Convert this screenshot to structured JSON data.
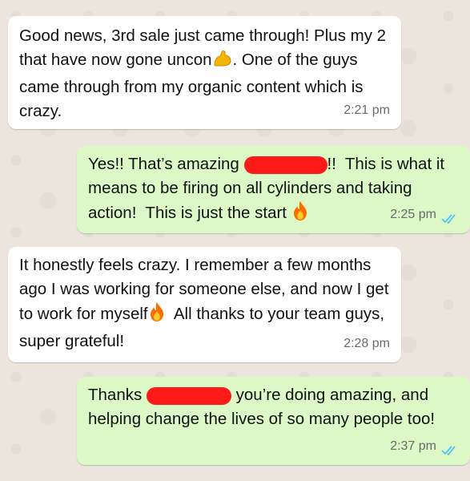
{
  "messages": [
    {
      "direction": "incoming",
      "text": "Good news, 3rd sale just came through! Plus my 2 that have now gone uncon",
      "emoji_icon": "flexed-biceps-icon",
      "text_after": ". One of the guys came through from my organic content which is crazy.",
      "time": "2:21 pm"
    },
    {
      "direction": "outgoing",
      "text": "Yes!! That’s amazing",
      "redacted": true,
      "text_after": "!!  This is what it means to be firing on all cylinders and taking action!  This is just the start",
      "emoji_icon": "fire-icon",
      "time": "2:25 pm",
      "status_icon": "double-check-read-icon"
    },
    {
      "direction": "incoming",
      "text": "It honestly feels crazy. I remember a few months ago I was working for someone else, and now I get to work for myself",
      "emoji_icon": "fire-icon",
      "text_after": "  All thanks to your team guys, super grateful!",
      "time": "2:28 pm"
    },
    {
      "direction": "outgoing",
      "text": "Thanks",
      "redacted": true,
      "text_after": "you’re doing amazing, and helping change the lives of so many people too!",
      "time": "2:37 pm",
      "status_icon": "double-check-read-icon"
    }
  ],
  "colors": {
    "incoming_bubble": "#ffffff",
    "outgoing_bubble": "#dcf8c6",
    "read_ticks": "#4fc3f7",
    "redaction": "#ff1a1a",
    "chat_background": "#ece5dd"
  }
}
